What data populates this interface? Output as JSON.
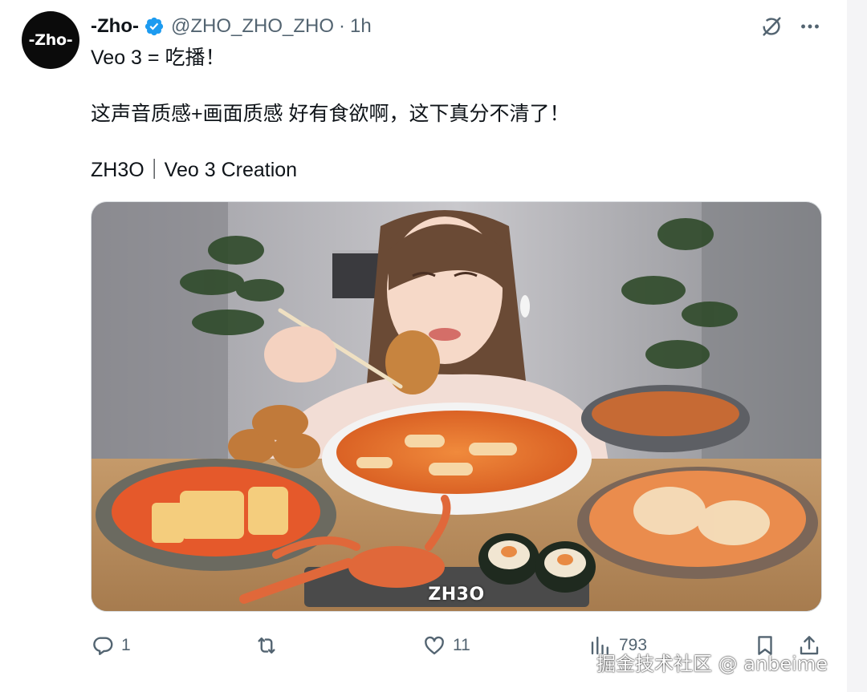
{
  "author": {
    "avatar_text": "-Zho-",
    "display_name": "-Zho-",
    "handle": "@ZHO_ZHO_ZHO",
    "separator": "·",
    "time": "1h",
    "verified": true
  },
  "tweet": {
    "line1": "Veo 3 = 吃播！",
    "line2": "这声音质感+画面质感 好有食欲啊，这下真分不清了！",
    "line3": "ZH3O｜Veo 3 Creation"
  },
  "media": {
    "watermark": "ZH3O"
  },
  "actions": {
    "replies": "1",
    "retweets": "",
    "likes": "11",
    "views": "793"
  },
  "icons": {
    "header": [
      "grok-icon",
      "more-icon"
    ],
    "actions": [
      "reply-icon",
      "retweet-icon",
      "like-icon",
      "views-icon",
      "bookmark-icon",
      "share-icon"
    ]
  },
  "colors": {
    "verified_blue": "#1d9bf0",
    "text_primary": "#0f1419",
    "text_secondary": "#536471"
  },
  "page_watermark": "掘金技术社区 @ anbeime"
}
